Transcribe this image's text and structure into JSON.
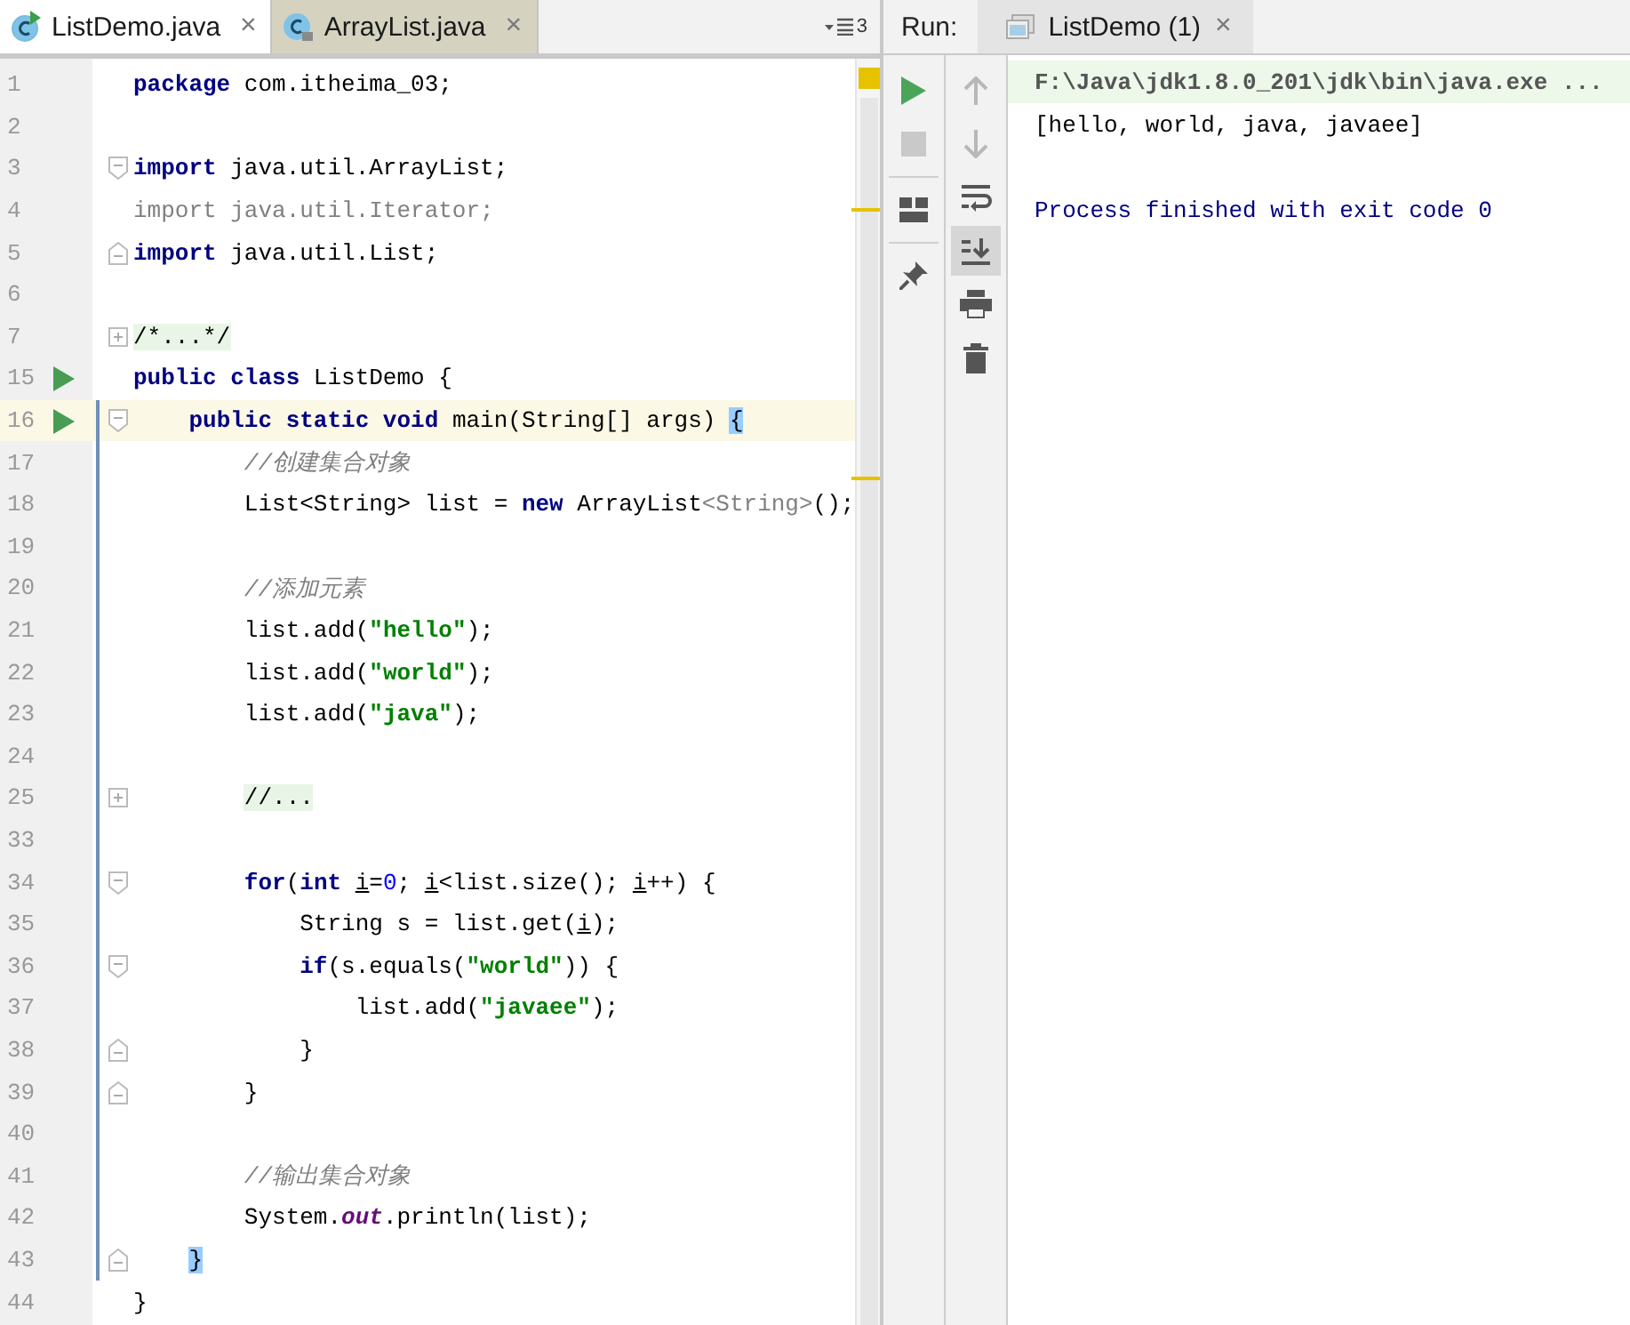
{
  "editor": {
    "tabs": [
      {
        "label": "ListDemo.java",
        "close": "×",
        "selected": true
      },
      {
        "label": "ArrayList.java",
        "close": "×",
        "selected": false
      }
    ],
    "tab_count": "3",
    "lines": [
      {
        "number": "1",
        "run": false,
        "current": false,
        "kind": "plain",
        "tokens": [
          {
            "kind": "keyword",
            "text": "package"
          },
          {
            "kind": "plain",
            "text": " com.itheima_03;"
          }
        ]
      },
      {
        "number": "2",
        "run": false,
        "current": false,
        "kind": "plain"
      },
      {
        "number": "3",
        "run": false,
        "current": false,
        "kind": "fold-start",
        "tokens": [
          {
            "kind": "keyword",
            "text": "import"
          },
          {
            "kind": "plain",
            "text": " java.util.ArrayList;"
          }
        ]
      },
      {
        "number": "4",
        "run": false,
        "current": false,
        "kind": "plain",
        "tokens": [
          {
            "kind": "unused",
            "text": "import java.util.Iterator;"
          }
        ]
      },
      {
        "number": "5",
        "run": false,
        "current": false,
        "kind": "fold-end",
        "tokens": [
          {
            "kind": "keyword",
            "text": "import"
          },
          {
            "kind": "plain",
            "text": " java.util.List;"
          }
        ]
      },
      {
        "number": "6",
        "run": false,
        "current": false,
        "kind": "plain"
      },
      {
        "number": "7",
        "run": false,
        "current": false,
        "kind": "folded",
        "tokens": [
          {
            "kind": "folded",
            "text": "/*...*/"
          }
        ]
      },
      {
        "number": "15",
        "run": true,
        "current": false,
        "kind": "plain",
        "tokens": [
          {
            "kind": "keyword",
            "text": "public class"
          },
          {
            "kind": "plain",
            "text": " ListDemo {"
          }
        ]
      },
      {
        "number": "16",
        "run": true,
        "current": true,
        "kind": "fold-start",
        "tokens": [
          {
            "kind": "keyword",
            "text": "    public static void"
          },
          {
            "kind": "plain",
            "text": " main(String[] args) "
          },
          {
            "kind": "match",
            "text": "{"
          }
        ]
      },
      {
        "number": "17",
        "run": false,
        "current": false,
        "kind": "plain",
        "tokens": [
          {
            "kind": "comment",
            "text": "        //创建集合对象"
          }
        ]
      },
      {
        "number": "18",
        "run": false,
        "current": false,
        "kind": "plain",
        "tokens": [
          {
            "kind": "plain",
            "text": "        List<String> list = "
          },
          {
            "kind": "keyword",
            "text": "new"
          },
          {
            "kind": "plain",
            "text": " ArrayList"
          },
          {
            "kind": "unused",
            "text": "<String>"
          },
          {
            "kind": "plain",
            "text": "();"
          }
        ]
      },
      {
        "number": "19",
        "run": false,
        "current": false,
        "kind": "plain"
      },
      {
        "number": "20",
        "run": false,
        "current": false,
        "kind": "plain",
        "tokens": [
          {
            "kind": "comment",
            "text": "        //添加元素"
          }
        ]
      },
      {
        "number": "21",
        "run": false,
        "current": false,
        "kind": "plain",
        "tokens": [
          {
            "kind": "plain",
            "text": "        list.add("
          },
          {
            "kind": "string",
            "text": "\"hello\""
          },
          {
            "kind": "plain",
            "text": ");"
          }
        ]
      },
      {
        "number": "22",
        "run": false,
        "current": false,
        "kind": "plain",
        "tokens": [
          {
            "kind": "plain",
            "text": "        list.add("
          },
          {
            "kind": "string",
            "text": "\"world\""
          },
          {
            "kind": "plain",
            "text": ");"
          }
        ]
      },
      {
        "number": "23",
        "run": false,
        "current": false,
        "kind": "plain",
        "tokens": [
          {
            "kind": "plain",
            "text": "        list.add("
          },
          {
            "kind": "string",
            "text": "\"java\""
          },
          {
            "kind": "plain",
            "text": ");"
          }
        ]
      },
      {
        "number": "24",
        "run": false,
        "current": false,
        "kind": "plain"
      },
      {
        "number": "25",
        "run": false,
        "current": false,
        "kind": "folded",
        "tokens": [
          {
            "kind": "folded",
            "text": "        //..."
          }
        ]
      },
      {
        "number": "33",
        "run": false,
        "current": false,
        "kind": "plain"
      },
      {
        "number": "34",
        "run": false,
        "current": false,
        "kind": "fold-start",
        "tokens": [
          {
            "kind": "keyword",
            "text": "        for"
          },
          {
            "kind": "plain",
            "text": "("
          },
          {
            "kind": "keyword",
            "text": "int "
          },
          {
            "kind": "var",
            "text": "i"
          },
          {
            "kind": "plain",
            "text": "="
          },
          {
            "kind": "number",
            "text": "0"
          },
          {
            "kind": "plain",
            "text": "; "
          },
          {
            "kind": "var",
            "text": "i"
          },
          {
            "kind": "plain",
            "text": "<list.size(); "
          },
          {
            "kind": "var",
            "text": "i"
          },
          {
            "kind": "plain",
            "text": "++) {"
          }
        ]
      },
      {
        "number": "35",
        "run": false,
        "current": false,
        "kind": "plain",
        "tokens": [
          {
            "kind": "plain",
            "text": "            String s = list.get("
          },
          {
            "kind": "var",
            "text": "i"
          },
          {
            "kind": "plain",
            "text": ");"
          }
        ]
      },
      {
        "number": "36",
        "run": false,
        "current": false,
        "kind": "fold-start",
        "tokens": [
          {
            "kind": "keyword",
            "text": "            if"
          },
          {
            "kind": "plain",
            "text": "(s.equals("
          },
          {
            "kind": "string",
            "text": "\"world\""
          },
          {
            "kind": "plain",
            "text": ")) {"
          }
        ]
      },
      {
        "number": "37",
        "run": false,
        "current": false,
        "kind": "plain",
        "tokens": [
          {
            "kind": "plain",
            "text": "                list.add("
          },
          {
            "kind": "string",
            "text": "\"javaee\""
          },
          {
            "kind": "plain",
            "text": ");"
          }
        ]
      },
      {
        "number": "38",
        "run": false,
        "current": false,
        "kind": "fold-end",
        "tokens": [
          {
            "kind": "plain",
            "text": "            }"
          }
        ]
      },
      {
        "number": "39",
        "run": false,
        "current": false,
        "kind": "fold-end",
        "tokens": [
          {
            "kind": "plain",
            "text": "        }"
          }
        ]
      },
      {
        "number": "40",
        "run": false,
        "current": false,
        "kind": "plain"
      },
      {
        "number": "41",
        "run": false,
        "current": false,
        "kind": "plain",
        "tokens": [
          {
            "kind": "comment",
            "text": "        //输出集合对象"
          }
        ]
      },
      {
        "number": "42",
        "run": false,
        "current": false,
        "kind": "plain",
        "tokens": [
          {
            "kind": "plain",
            "text": "        System."
          },
          {
            "kind": "static",
            "text": "out"
          },
          {
            "kind": "plain",
            "text": ".println(list);"
          }
        ]
      },
      {
        "number": "43",
        "run": false,
        "current": false,
        "kind": "fold-end",
        "tokens": [
          {
            "kind": "match",
            "text": "    }"
          }
        ]
      },
      {
        "number": "44",
        "run": false,
        "current": false,
        "kind": "plain",
        "tokens": [
          {
            "kind": "plain",
            "text": "}"
          }
        ]
      }
    ]
  },
  "run": {
    "label": "Run:",
    "tabs": [
      {
        "label": "ListDemo (1)",
        "close": "×",
        "selected": true
      }
    ],
    "left_tools": [
      {
        "kind": "run",
        "disabled": false
      },
      {
        "kind": "stop",
        "disabled": true
      },
      {
        "kind": "layout",
        "disabled": false
      },
      {
        "kind": "pin",
        "disabled": false
      }
    ],
    "right_tools": [
      {
        "kind": "up",
        "disabled": true,
        "on": false
      },
      {
        "kind": "down",
        "disabled": true,
        "on": false
      },
      {
        "kind": "wrap",
        "disabled": false,
        "on": false
      },
      {
        "kind": "scroll-end",
        "disabled": false,
        "on": true
      },
      {
        "kind": "print",
        "disabled": false,
        "on": false
      },
      {
        "kind": "trash",
        "disabled": false,
        "on": false
      }
    ],
    "console": [
      {
        "kind": "command",
        "text": "F:\\Java\\jdk1.8.0_201\\jdk\\bin\\java.exe ..."
      },
      {
        "kind": "output",
        "text": "[hello, world, java, javaee]"
      },
      {
        "kind": "blank"
      },
      {
        "kind": "system",
        "text": "Process finished with exit code 0"
      }
    ]
  }
}
